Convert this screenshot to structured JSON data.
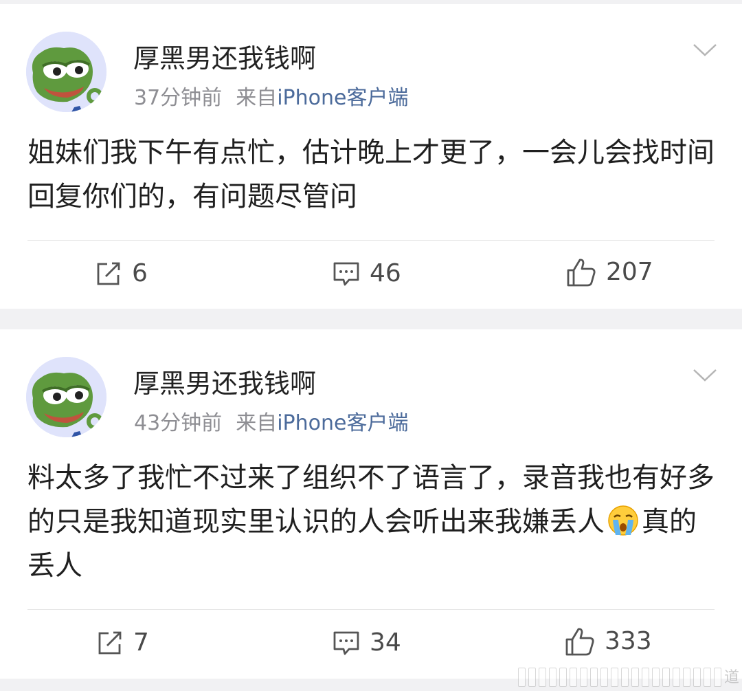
{
  "posts": [
    {
      "username": "厚黑男还我钱啊",
      "time": "37分钟前",
      "from_prefix": "来自",
      "source": "iPhone客户端",
      "content": "姐妹们我下午有点忙，估计晚上才更了，一会儿会找时间回复你们的，有问题尽管问",
      "reposts": "6",
      "comments": "46",
      "likes": "207"
    },
    {
      "username": "厚黑男还我钱啊",
      "time": "43分钟前",
      "from_prefix": "来自",
      "source": "iPhone客户端",
      "content_part1": "料太多了我忙不过来了组织不了语言了，录音我也有好多的只是我知道现实里认识的人会听出来我嫌丢人",
      "content_emoji": "crying-face-emoji",
      "content_part2": "真的丢人",
      "reposts": "7",
      "comments": "34",
      "likes": "333"
    }
  ],
  "icons": {
    "avatar": "frog-ok-hand-avatar",
    "menu": "chevron-down-icon",
    "repost": "share-icon",
    "comment": "comment-icon",
    "like": "thumbs-up-icon"
  },
  "watermark_glyph": "道",
  "colors": {
    "page_background": "#f1f1f3",
    "card_background": "#ffffff",
    "username": "#222222",
    "meta_grey": "#8e8e93",
    "source_link": "#4c6b9b",
    "body_text": "#1f1f1f",
    "action_text": "#4a4a4a"
  }
}
